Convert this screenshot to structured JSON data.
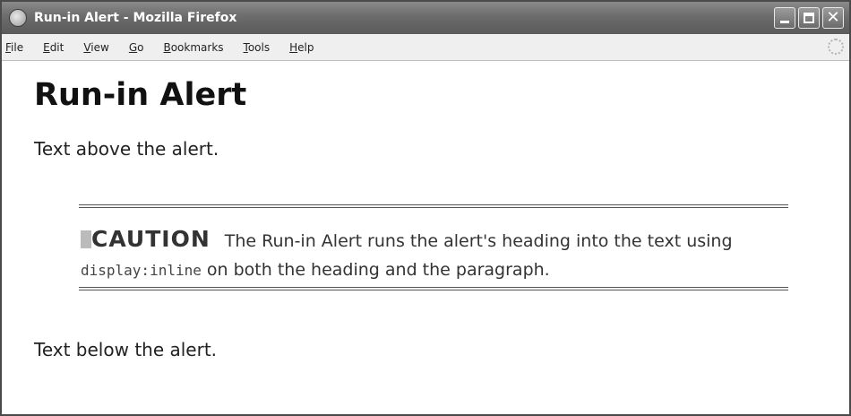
{
  "window": {
    "title": "Run-in Alert - Mozilla Firefox",
    "close_glyph": "✕"
  },
  "menu": [
    {
      "mnemonic": "F",
      "rest": "ile"
    },
    {
      "mnemonic": "E",
      "rest": "dit"
    },
    {
      "mnemonic": "V",
      "rest": "iew"
    },
    {
      "mnemonic": "G",
      "rest": "o"
    },
    {
      "mnemonic": "B",
      "rest": "ookmarks"
    },
    {
      "mnemonic": "T",
      "rest": "ools"
    },
    {
      "mnemonic": "H",
      "rest": "elp"
    }
  ],
  "page": {
    "heading": "Run-in Alert",
    "text_above": "Text above the alert.",
    "alert": {
      "heading": "CAUTION",
      "text_before_code": "The Run-in Alert runs the alert's heading into the text using ",
      "code": "display:inline",
      "text_after_code": " on both the heading and the paragraph."
    },
    "text_below": "Text below the alert."
  },
  "icons": {
    "app": "firefox-globe-icon",
    "throbber": "throbber-icon"
  }
}
